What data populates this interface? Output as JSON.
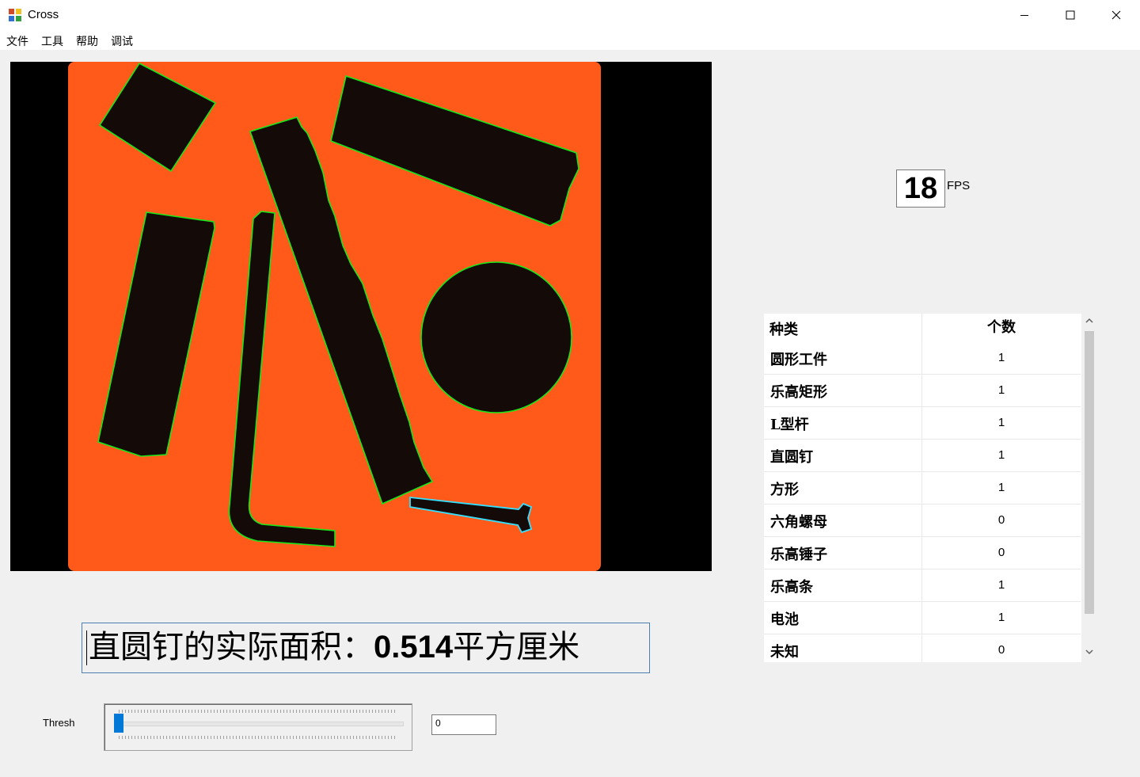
{
  "window": {
    "title": "Cross"
  },
  "menu": [
    "文件",
    "工具",
    "帮助",
    "调试"
  ],
  "area_display": {
    "prefix": "直圆钉的实际面积：",
    "value": "0.514",
    "unit": "平方厘米"
  },
  "fps": {
    "value": "18",
    "label": "FPS"
  },
  "table": {
    "headers": [
      "种类",
      "个数"
    ],
    "rows": [
      {
        "type": "圆形工件",
        "count": "1"
      },
      {
        "type": "乐高矩形",
        "count": "1"
      },
      {
        "type": "L型杆",
        "count": "1"
      },
      {
        "type": "直圆钉",
        "count": "1"
      },
      {
        "type": "方形",
        "count": "1"
      },
      {
        "type": "六角螺母",
        "count": "0"
      },
      {
        "type": "乐高锤子",
        "count": "0"
      },
      {
        "type": "乐高条",
        "count": "1"
      },
      {
        "type": "电池",
        "count": "1"
      },
      {
        "type": "未知",
        "count": "0"
      }
    ]
  },
  "threshold": {
    "label": "Thresh",
    "value": "0",
    "slider_fraction": 0.0
  },
  "colors": {
    "backlight": "#ff5a1a",
    "contour": "#19e619",
    "contour_highlight": "#33e0ff",
    "accent": "#0078d7"
  }
}
